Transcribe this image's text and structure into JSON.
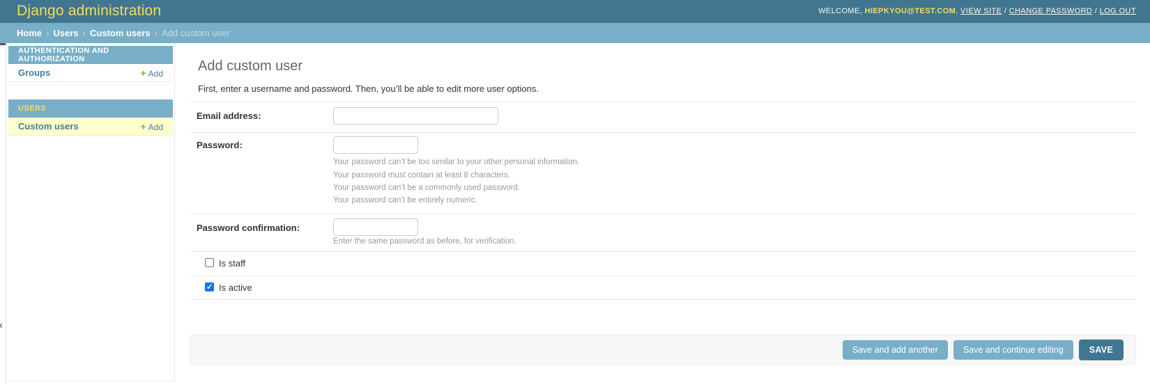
{
  "header": {
    "brand": "Django administration",
    "welcome_prefix": "WELCOME,",
    "username": "HIEPKYOU@TEST.COM",
    "after_username": ".",
    "links": [
      {
        "label": "VIEW SITE"
      },
      {
        "label": "CHANGE PASSWORD"
      },
      {
        "label": "LOG OUT"
      }
    ],
    "link_separator": "/"
  },
  "breadcrumbs": {
    "separator": "›",
    "items": [
      {
        "label": "Home"
      },
      {
        "label": "Users"
      },
      {
        "label": "Custom users"
      },
      {
        "label": "Add custom user"
      }
    ]
  },
  "sidebar": {
    "toggle_arrow": "‹",
    "sections": [
      {
        "title": "AUTHENTICATION AND AUTHORIZATION",
        "current": false,
        "rows": [
          {
            "label": "Groups",
            "add_label": "Add",
            "plus": "+",
            "highlighted": false
          }
        ]
      },
      {
        "title": "USERS",
        "current": true,
        "rows": [
          {
            "label": "Custom users",
            "add_label": "Add",
            "plus": "+",
            "highlighted": true
          }
        ]
      }
    ]
  },
  "main": {
    "title": "Add custom user",
    "intro": "First, enter a username and password. Then, you’ll be able to edit more user options.",
    "fields": {
      "email": {
        "label": "Email address:",
        "value": "",
        "help": []
      },
      "password": {
        "label": "Password:",
        "value": "",
        "help": [
          "Your password can’t be too similar to your other personal information.",
          "Your password must contain at least 8 characters.",
          "Your password can’t be a commonly used password.",
          "Your password can’t be entirely numeric."
        ]
      },
      "password_confirmation": {
        "label": "Password confirmation:",
        "value": "",
        "help": [
          "Enter the same password as before, for verification."
        ]
      }
    },
    "checkbox_rows": [
      {
        "label": "Is staff",
        "checked": false
      },
      {
        "label": "Is active",
        "checked": true
      }
    ]
  },
  "submit_row": {
    "buttons": [
      {
        "label": "Save and add another",
        "default": false
      },
      {
        "label": "Save and continue editing",
        "default": false
      },
      {
        "label": "SAVE",
        "default": true
      }
    ]
  },
  "colors": {
    "header_bg": "#417690",
    "brand_yellow": "#f5dd5d",
    "header_text": "#fffbe8",
    "breadcrumbs_bg": "#79aec8",
    "breadcrumbs_fg": "#c4dce8",
    "link_blue": "#447e9b",
    "module_caption_bg": "#79aec8",
    "highlight_row_bg": "#ffffcc",
    "add_plus_green": "#70bf2b",
    "button_bg": "#79aec8",
    "default_button_bg": "#417690",
    "checkbox_checked_blue": "#1a73e8",
    "help_text_gray": "#999999",
    "divider": "#eeeeee",
    "title_gray": "#666666"
  }
}
